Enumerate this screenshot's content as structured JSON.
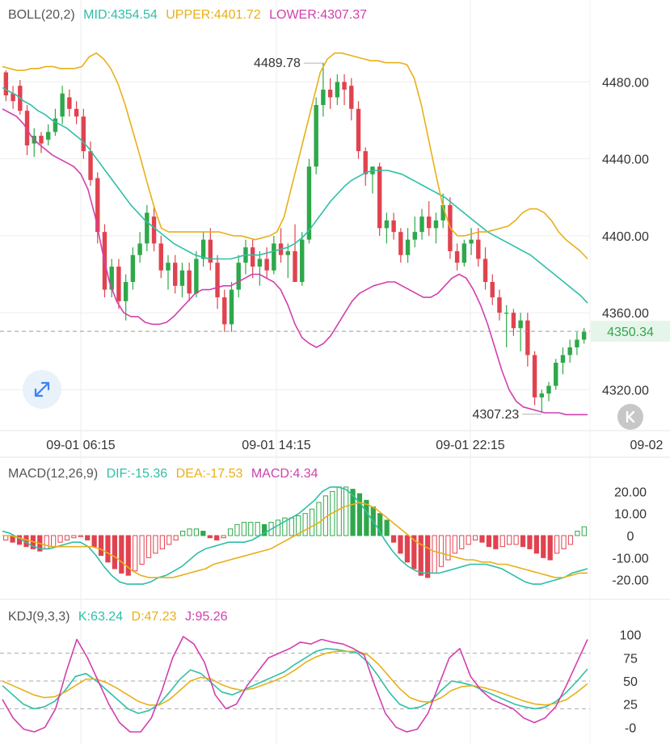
{
  "boll": {
    "label": "BOLL(20,2)",
    "mid": "MID:4354.54",
    "upper": "UPPER:4401.72",
    "lower": "LOWER:4307.37"
  },
  "macd": {
    "label": "MACD(12,26,9)",
    "dif": "DIF:-15.36",
    "dea": "DEA:-17.53",
    "macd": "MACD:4.34"
  },
  "kdj": {
    "label": "KDJ(9,3,3)",
    "k": "K:63.24",
    "d": "D:47.23",
    "j": "J:95.26"
  },
  "colors": {
    "up": "#2ea84a",
    "down": "#e0434f",
    "mid": "#2fbfa7",
    "upper": "#e8b018",
    "lower": "#d23fae",
    "grid": "#eeeeee",
    "text": "#333333",
    "muted": "#888888",
    "last_bg": "#e6f5ea"
  },
  "icons": {
    "expand": "expand-arrows-icon",
    "collapse": "collapse-left-icon"
  },
  "chart_data": [
    {
      "type": "candlestick",
      "title": "BOLL(20,2)",
      "x_ticks": [
        "09-01 06:15",
        "09-01 14:15",
        "09-01 22:15",
        "09-02"
      ],
      "y_ticks": [
        "4480.00",
        "4440.00",
        "4400.00",
        "4360.00",
        "4320.00"
      ],
      "ylim": [
        4300,
        4510
      ],
      "max_label": "4489.78",
      "min_label": "4307.23",
      "last_price": "4350.34",
      "ohlc": [
        [
          4485,
          4486,
          4470,
          4473
        ],
        [
          4474,
          4478,
          4466,
          4470
        ],
        [
          4478,
          4481,
          4463,
          4465
        ],
        [
          4465,
          4468,
          4442,
          4447
        ],
        [
          4448,
          4456,
          4441,
          4452
        ],
        [
          4452,
          4454,
          4443,
          4448
        ],
        [
          4450,
          4458,
          4447,
          4454
        ],
        [
          4454,
          4466,
          4452,
          4461
        ],
        [
          4462,
          4478,
          4458,
          4474
        ],
        [
          4472,
          4476,
          4462,
          4466
        ],
        [
          4466,
          4470,
          4458,
          4462
        ],
        [
          4462,
          4466,
          4440,
          4444
        ],
        [
          4444,
          4449,
          4426,
          4429
        ],
        [
          4430,
          4433,
          4396,
          4402
        ],
        [
          4402,
          4406,
          4368,
          4372
        ],
        [
          4372,
          4388,
          4368,
          4384
        ],
        [
          4384,
          4388,
          4362,
          4366
        ],
        [
          4366,
          4380,
          4356,
          4376
        ],
        [
          4376,
          4394,
          4372,
          4390
        ],
        [
          4390,
          4402,
          4386,
          4396
        ],
        [
          4396,
          4416,
          4392,
          4412
        ],
        [
          4410,
          4416,
          4392,
          4396
        ],
        [
          4396,
          4400,
          4378,
          4382
        ],
        [
          4382,
          4390,
          4372,
          4386
        ],
        [
          4386,
          4390,
          4370,
          4374
        ],
        [
          4374,
          4386,
          4368,
          4382
        ],
        [
          4382,
          4386,
          4366,
          4370
        ],
        [
          4370,
          4392,
          4368,
          4388
        ],
        [
          4388,
          4402,
          4384,
          4398
        ],
        [
          4398,
          4404,
          4382,
          4386
        ],
        [
          4386,
          4390,
          4362,
          4368
        ],
        [
          4368,
          4372,
          4350,
          4354
        ],
        [
          4354,
          4376,
          4350,
          4372
        ],
        [
          4372,
          4390,
          4368,
          4386
        ],
        [
          4386,
          4398,
          4380,
          4394
        ],
        [
          4394,
          4398,
          4378,
          4384
        ],
        [
          4384,
          4392,
          4374,
          4388
        ],
        [
          4388,
          4394,
          4378,
          4382
        ],
        [
          4382,
          4400,
          4380,
          4396
        ],
        [
          4396,
          4404,
          4386,
          4390
        ],
        [
          4390,
          4396,
          4378,
          4392
        ],
        [
          4392,
          4406,
          4384,
          4376
        ],
        [
          4376,
          4402,
          4374,
          4398
        ],
        [
          4398,
          4440,
          4396,
          4436
        ],
        [
          4436,
          4472,
          4432,
          4468
        ],
        [
          4468,
          4490,
          4462,
          4476
        ],
        [
          4476,
          4482,
          4466,
          4472
        ],
        [
          4472,
          4484,
          4468,
          4480
        ],
        [
          4480,
          4484,
          4468,
          4476
        ],
        [
          4478,
          4482,
          4460,
          4466
        ],
        [
          4466,
          4470,
          4440,
          4444
        ],
        [
          4444,
          4446,
          4426,
          4432
        ],
        [
          4432,
          4436,
          4422,
          4436
        ],
        [
          4436,
          4438,
          4400,
          4404
        ],
        [
          4404,
          4412,
          4396,
          4408
        ],
        [
          4408,
          4412,
          4398,
          4402
        ],
        [
          4402,
          4404,
          4386,
          4390
        ],
        [
          4390,
          4404,
          4386,
          4398
        ],
        [
          4398,
          4410,
          4394,
          4402
        ],
        [
          4402,
          4414,
          4398,
          4410
        ],
        [
          4410,
          4418,
          4400,
          4404
        ],
        [
          4404,
          4412,
          4396,
          4408
        ],
        [
          4408,
          4422,
          4404,
          4416
        ],
        [
          4416,
          4420,
          4388,
          4392
        ],
        [
          4392,
          4396,
          4382,
          4386
        ],
        [
          4386,
          4398,
          4384,
          4396
        ],
        [
          4396,
          4404,
          4390,
          4398
        ],
        [
          4398,
          4404,
          4384,
          4388
        ],
        [
          4388,
          4394,
          4372,
          4376
        ],
        [
          4376,
          4380,
          4364,
          4368
        ],
        [
          4368,
          4372,
          4356,
          4360
        ],
        [
          4360,
          4364,
          4342,
          4360
        ],
        [
          4360,
          4362,
          4348,
          4352
        ],
        [
          4352,
          4360,
          4340,
          4356
        ],
        [
          4356,
          4360,
          4332,
          4338
        ],
        [
          4338,
          4340,
          4312,
          4316
        ],
        [
          4316,
          4320,
          4308,
          4318
        ],
        [
          4318,
          4324,
          4314,
          4322
        ],
        [
          4322,
          4336,
          4320,
          4334
        ],
        [
          4334,
          4342,
          4328,
          4338
        ],
        [
          4338,
          4346,
          4334,
          4342
        ],
        [
          4342,
          4350,
          4338,
          4346
        ],
        [
          4346,
          4352,
          4344,
          4350
        ]
      ],
      "series": [
        {
          "name": "MID",
          "values": [
            4477,
            4475,
            4473,
            4470,
            4468,
            4465,
            4463,
            4460,
            4458,
            4456,
            4453,
            4450,
            4446,
            4441,
            4436,
            4431,
            4426,
            4421,
            4416,
            4412,
            4408,
            4405,
            4402,
            4399,
            4396,
            4394,
            4392,
            4390,
            4389,
            4388,
            4388,
            4388,
            4388,
            4389,
            4390,
            4390,
            4390,
            4391,
            4392,
            4393,
            4394,
            4396,
            4399,
            4403,
            4408,
            4413,
            4418,
            4422,
            4426,
            4429,
            4431,
            4433,
            4434,
            4434,
            4434,
            4433,
            4432,
            4430,
            4428,
            4426,
            4424,
            4422,
            4420,
            4417,
            4414,
            4411,
            4408,
            4405,
            4402,
            4400,
            4398,
            4396,
            4394,
            4392,
            4390,
            4387,
            4384,
            4381,
            4378,
            4375,
            4372,
            4369,
            4365
          ]
        },
        {
          "name": "UPPER",
          "values": [
            4488,
            4487,
            4486,
            4486,
            4487,
            4487,
            4488,
            4488,
            4487,
            4487,
            4487,
            4488,
            4493,
            4495,
            4492,
            4487,
            4479,
            4468,
            4455,
            4442,
            4428,
            4415,
            4404,
            4402,
            4402,
            4402,
            4402,
            4402,
            4402,
            4402,
            4402,
            4401,
            4400,
            4400,
            4399,
            4398,
            4399,
            4400,
            4402,
            4410,
            4425,
            4440,
            4455,
            4470,
            4485,
            4492,
            4495,
            4495,
            4494,
            4493,
            4492,
            4491,
            4491,
            4490,
            4490,
            4490,
            4489,
            4482,
            4468,
            4450,
            4432,
            4415,
            4404,
            4400,
            4400,
            4401,
            4402,
            4402,
            4403,
            4404,
            4405,
            4408,
            4412,
            4414,
            4414,
            4412,
            4408,
            4402,
            4398,
            4395,
            4392,
            4388
          ]
        },
        {
          "name": "LOWER",
          "values": [
            4466,
            4464,
            4462,
            4458,
            4452,
            4448,
            4445,
            4442,
            4440,
            4438,
            4436,
            4432,
            4424,
            4410,
            4392,
            4376,
            4366,
            4360,
            4358,
            4358,
            4355,
            4354,
            4354,
            4355,
            4358,
            4362,
            4366,
            4370,
            4372,
            4372,
            4373,
            4374,
            4374,
            4376,
            4378,
            4380,
            4380,
            4378,
            4376,
            4372,
            4364,
            4354,
            4347,
            4344,
            4342,
            4344,
            4348,
            4354,
            4360,
            4366,
            4370,
            4372,
            4374,
            4375,
            4376,
            4376,
            4374,
            4372,
            4370,
            4368,
            4368,
            4370,
            4374,
            4378,
            4380,
            4378,
            4372,
            4364,
            4354,
            4342,
            4330,
            4320,
            4314,
            4311,
            4310,
            4309,
            4308,
            4308,
            4308,
            4307,
            4307,
            4307,
            4307
          ]
        }
      ]
    },
    {
      "type": "bar",
      "title": "MACD(12,26,9)",
      "y_ticks": [
        "20.00",
        "10.00",
        "0",
        "-10.00",
        "-20.00"
      ],
      "ylim": [
        -26,
        26
      ],
      "histogram": [
        -2,
        -3,
        -4,
        -5,
        -6,
        -7,
        -6,
        -5,
        -3,
        -2,
        -1,
        -0.5,
        -2,
        -5,
        -9,
        -12,
        -15,
        -17,
        -18,
        -16,
        -13,
        -10,
        -8,
        -6,
        -4,
        -2,
        2,
        3,
        3,
        2,
        -1,
        -2,
        -1,
        3,
        5,
        6,
        6,
        6,
        5,
        6,
        7,
        8,
        8,
        9,
        10,
        12,
        15,
        18,
        20,
        22,
        22,
        21,
        19,
        16,
        13,
        10,
        7,
        -3,
        -8,
        -12,
        -15,
        -18,
        -19,
        -17,
        -14,
        -11,
        -8,
        -6,
        -4,
        -2,
        -3,
        -5,
        -6,
        -5,
        -4,
        -4,
        -5,
        -6,
        -8,
        -10,
        -11,
        -8,
        -6,
        -4,
        2,
        4
      ],
      "series": [
        {
          "name": "DIF",
          "values": [
            2,
            1,
            -1,
            -3,
            -5,
            -6,
            -6,
            -5,
            -4,
            -3,
            -3,
            -5,
            -9,
            -14,
            -18,
            -21,
            -22,
            -22,
            -22,
            -21,
            -19,
            -18,
            -16,
            -14,
            -11,
            -8,
            -6,
            -5,
            -4,
            -3,
            -3,
            -3,
            -2,
            0,
            2,
            4,
            6,
            8,
            10,
            13,
            16,
            20,
            22,
            22,
            21,
            18,
            14,
            9,
            4,
            -2,
            -7,
            -11,
            -14,
            -16,
            -17,
            -17,
            -17,
            -16,
            -15,
            -14,
            -13,
            -13,
            -13,
            -14,
            -15,
            -17,
            -19,
            -21,
            -22,
            -22,
            -21,
            -20,
            -19,
            -17,
            -16,
            -15
          ]
        },
        {
          "name": "DEA",
          "values": [
            0,
            0,
            -1,
            -2,
            -3,
            -4,
            -5,
            -5,
            -5,
            -5,
            -5,
            -5,
            -6,
            -8,
            -10,
            -13,
            -16,
            -18,
            -19,
            -19,
            -19,
            -19,
            -18,
            -17,
            -16,
            -15,
            -13,
            -12,
            -11,
            -10,
            -9,
            -8,
            -7,
            -6,
            -4,
            -2,
            0,
            2,
            4,
            6,
            9,
            11,
            13,
            14,
            15,
            14,
            12,
            9,
            6,
            3,
            0,
            -3,
            -5,
            -7,
            -8,
            -9,
            -10,
            -11,
            -11,
            -12,
            -12,
            -13,
            -13,
            -14,
            -15,
            -16,
            -17,
            -18,
            -19,
            -19,
            -18,
            -17,
            -17
          ]
        }
      ]
    },
    {
      "type": "line",
      "title": "KDJ(9,3,3)",
      "y_ticks": [
        "100",
        "75",
        "50",
        "25",
        "-0"
      ],
      "ylim": [
        -5,
        105
      ],
      "series": [
        {
          "name": "K",
          "values": [
            45,
            35,
            25,
            20,
            22,
            28,
            40,
            55,
            58,
            50,
            40,
            30,
            20,
            15,
            18,
            25,
            38,
            52,
            62,
            58,
            48,
            38,
            35,
            40,
            45,
            50,
            55,
            60,
            68,
            75,
            82,
            85,
            84,
            82,
            80,
            70,
            55,
            38,
            25,
            20,
            22,
            28,
            40,
            50,
            48,
            45,
            40,
            35,
            30,
            25,
            22,
            20,
            22,
            28,
            38,
            50,
            63
          ]
        },
        {
          "name": "D",
          "values": [
            50,
            45,
            40,
            35,
            32,
            33,
            38,
            45,
            52,
            52,
            48,
            42,
            35,
            28,
            24,
            24,
            30,
            40,
            50,
            54,
            52,
            46,
            42,
            40,
            42,
            46,
            50,
            55,
            62,
            70,
            76,
            80,
            82,
            82,
            82,
            78,
            68,
            55,
            42,
            32,
            28,
            27,
            32,
            40,
            44,
            45,
            43,
            40,
            36,
            32,
            28,
            25,
            24,
            26,
            30,
            38,
            47
          ]
        },
        {
          "name": "J",
          "values": [
            30,
            10,
            -2,
            -5,
            0,
            20,
            60,
            95,
            75,
            50,
            25,
            5,
            -5,
            -5,
            10,
            40,
            75,
            98,
            90,
            70,
            35,
            20,
            25,
            45,
            60,
            75,
            80,
            85,
            92,
            90,
            95,
            92,
            90,
            85,
            78,
            45,
            15,
            0,
            -5,
            -2,
            15,
            45,
            75,
            85,
            55,
            40,
            30,
            25,
            20,
            10,
            5,
            10,
            22,
            45,
            70,
            95
          ]
        }
      ]
    }
  ]
}
